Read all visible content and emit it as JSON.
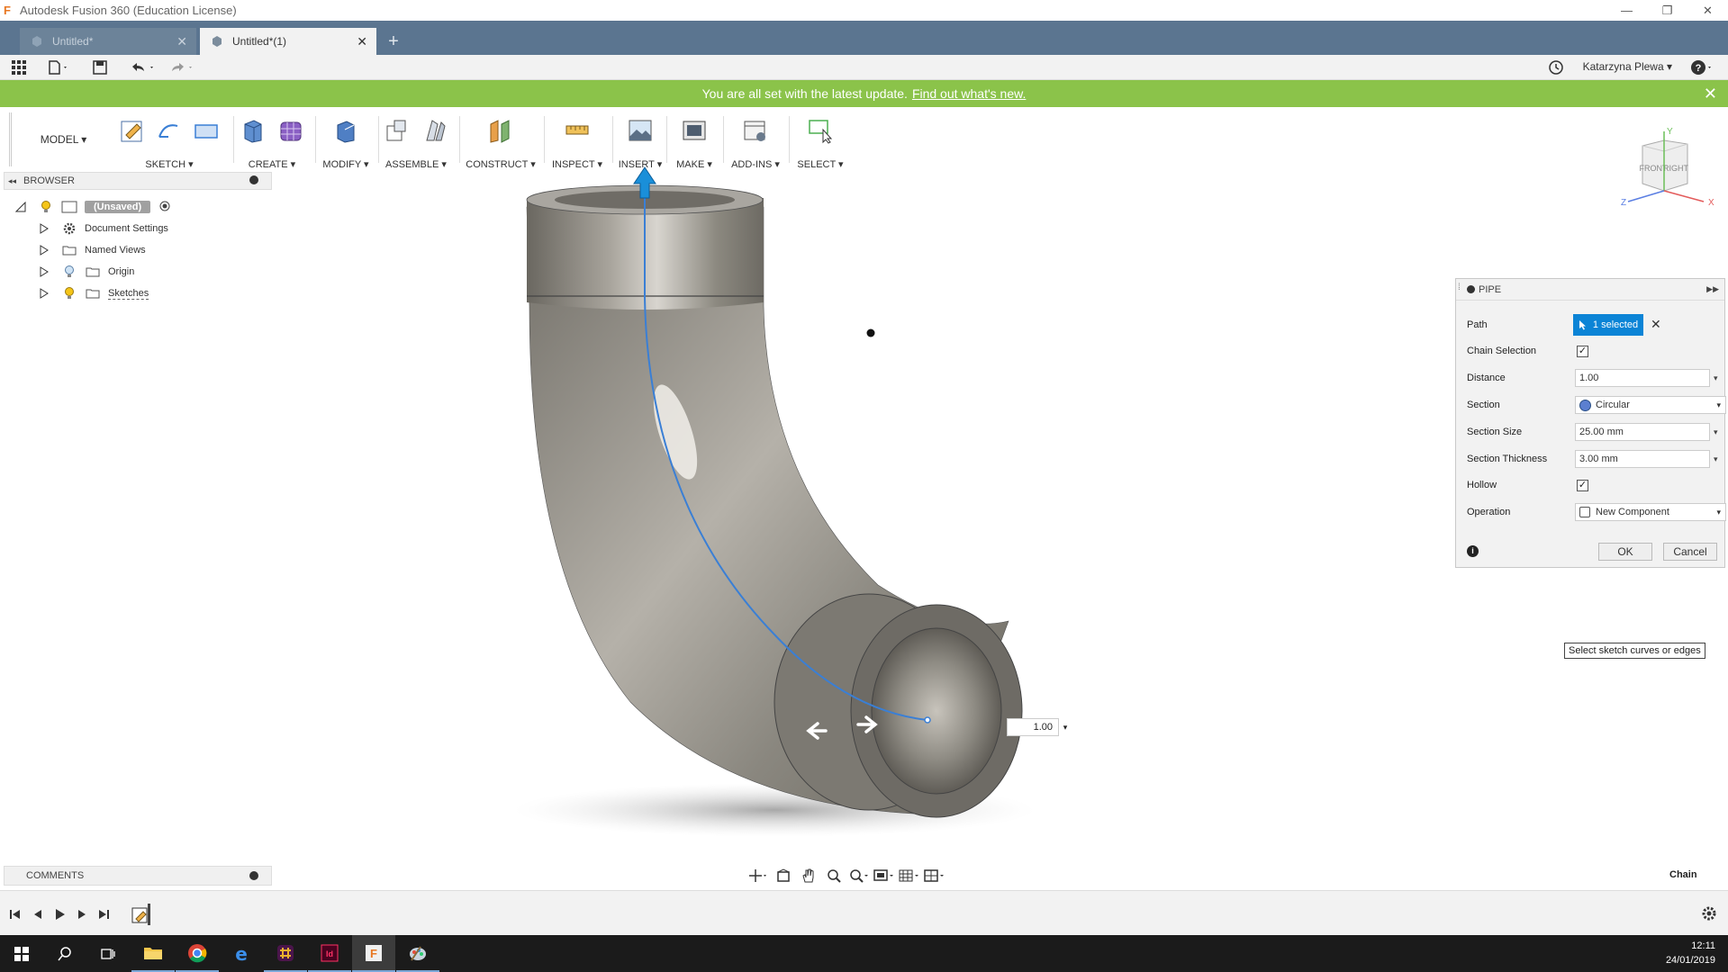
{
  "window": {
    "title": "Autodesk Fusion 360 (Education License)",
    "app_logo": "F",
    "minimize": "—",
    "restore": "❐",
    "close": "✕"
  },
  "tabs": [
    {
      "label": "Untitled*",
      "active": false
    },
    {
      "label": "Untitled*(1)",
      "active": true
    }
  ],
  "new_tab_label": "+",
  "user": {
    "name": "Katarzyna Plewa ▾"
  },
  "banner": {
    "text": "You are all set with the latest update.",
    "link": "Find out what's new."
  },
  "ribbon": {
    "workspace": "MODEL ▾",
    "groups": [
      "SKETCH ▾",
      "CREATE ▾",
      "MODIFY ▾",
      "ASSEMBLE ▾",
      "CONSTRUCT ▾",
      "INSPECT ▾",
      "INSERT ▾",
      "MAKE ▾",
      "ADD-INS ▾",
      "SELECT ▾"
    ]
  },
  "browser": {
    "title": "BROWSER",
    "root": "(Unsaved)",
    "items": [
      "Document Settings",
      "Named Views",
      "Origin",
      "Sketches"
    ]
  },
  "comments": {
    "title": "COMMENTS"
  },
  "viewcube": {
    "front": "FRONT",
    "right": "RIGHT",
    "axis_x": "X",
    "axis_y": "Y",
    "axis_z": "Z"
  },
  "pipe": {
    "title": "PIPE",
    "path_label": "Path",
    "path_value": "1 selected",
    "chain_label": "Chain Selection",
    "distance_label": "Distance",
    "distance_value": "1.00",
    "section_label": "Section",
    "section_value": "Circular",
    "size_label": "Section Size",
    "size_value": "25.00 mm",
    "thickness_label": "Section Thickness",
    "thickness_value": "3.00 mm",
    "hollow_label": "Hollow",
    "operation_label": "Operation",
    "operation_value": "New Component",
    "ok": "OK",
    "cancel": "Cancel",
    "checkmark": "✓",
    "dropdown_arrow": "▾"
  },
  "tooltip": "Select sketch curves or edges",
  "dimension_value": "1.00",
  "status_label": "Chain",
  "clock": {
    "time": "12:11",
    "date": "24/01/2019"
  },
  "colors": {
    "banner": "#8bc34a",
    "tabstrip": "#5b7590",
    "selection": "#0b84d6",
    "pipe_body": "#8a8880"
  }
}
